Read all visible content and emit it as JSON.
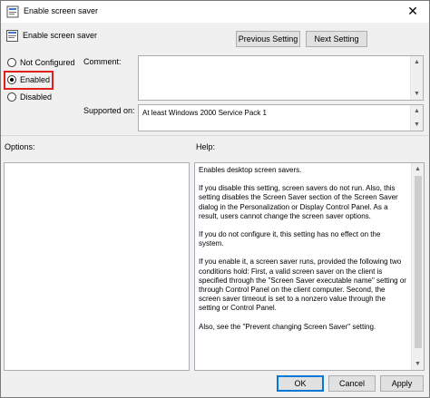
{
  "window": {
    "title": "Enable screen saver"
  },
  "policy": {
    "name": "Enable screen saver"
  },
  "nav": {
    "previous": "Previous Setting",
    "next": "Next Setting"
  },
  "state": {
    "options": [
      {
        "label": "Not Configured",
        "checked": false
      },
      {
        "label": "Enabled",
        "checked": true
      },
      {
        "label": "Disabled",
        "checked": false
      }
    ]
  },
  "comment": {
    "label": "Comment:",
    "value": ""
  },
  "supported": {
    "label": "Supported on:",
    "value": "At least Windows 2000 Service Pack 1"
  },
  "options_panel": {
    "label": "Options:"
  },
  "help": {
    "label": "Help:",
    "paragraphs": [
      "Enables desktop screen savers.",
      "If you disable this setting, screen savers do not run. Also, this setting disables the Screen Saver section of the Screen Saver dialog in the Personalization or Display Control Panel. As a result, users cannot change the screen saver options.",
      "If you do not configure it, this setting has no effect on the system.",
      "If you enable it, a screen saver runs, provided the following two conditions hold: First, a valid screen saver on the client is specified through the \"Screen Saver executable name\" setting or through Control Panel on the client computer. Second, the screen saver timeout is set to a nonzero value through the setting or Control Panel.",
      "Also, see the \"Prevent changing Screen Saver\" setting."
    ]
  },
  "footer": {
    "ok": "OK",
    "cancel": "Cancel",
    "apply": "Apply"
  },
  "colors": {
    "highlight": "#e0201b",
    "accent": "#0078d7"
  }
}
